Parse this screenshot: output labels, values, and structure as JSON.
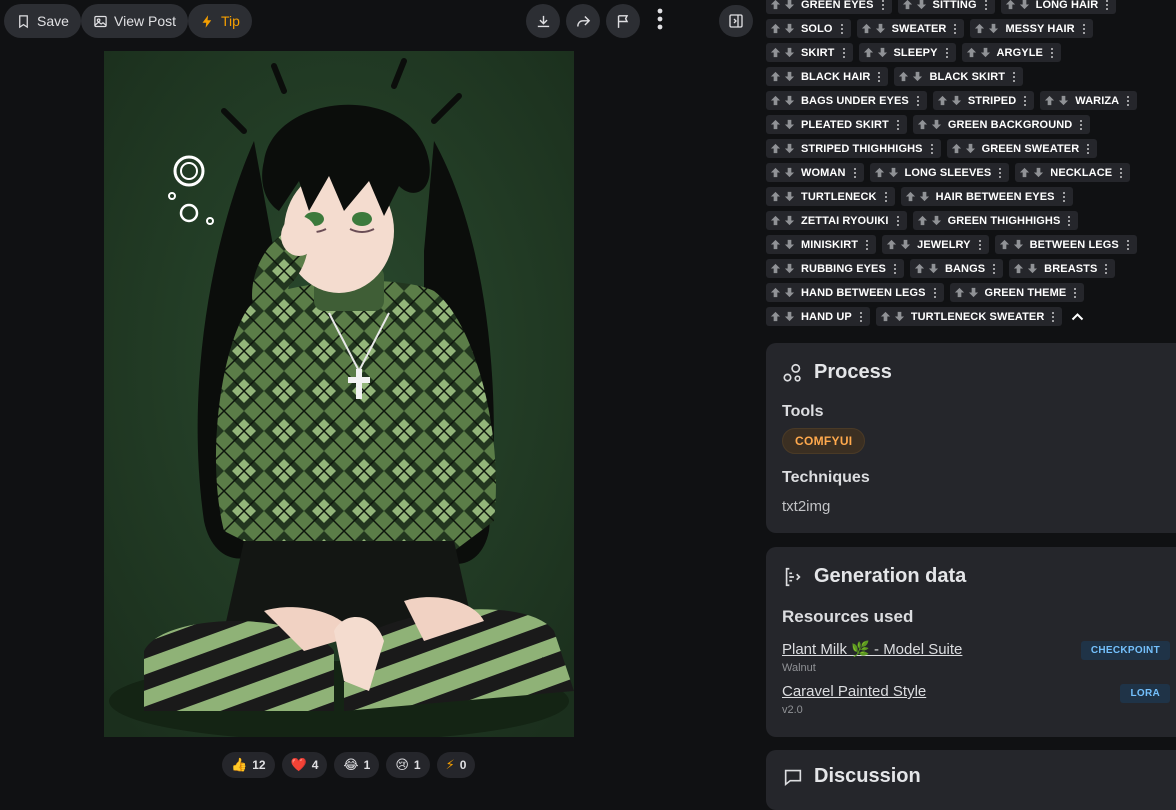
{
  "toolbar": {
    "save_label": "Save",
    "view_post_label": "View Post",
    "tip_label": "Tip"
  },
  "reactions": [
    {
      "emoji": "👍",
      "count": "12"
    },
    {
      "emoji": "❤️",
      "count": "4"
    },
    {
      "emoji": "😂",
      "count": "1"
    },
    {
      "emoji": "😢",
      "count": "1"
    },
    {
      "emoji": "⚡",
      "count": "0"
    }
  ],
  "tag_rows": [
    [
      "GREEN EYES",
      "SITTING",
      "LONG HAIR"
    ],
    [
      "SOLO",
      "SWEATER",
      "MESSY HAIR"
    ],
    [
      "SKIRT",
      "SLEEPY",
      "ARGYLE"
    ],
    [
      "BLACK HAIR",
      "BLACK SKIRT"
    ],
    [
      "BAGS UNDER EYES",
      "STRIPED",
      "WARIZA"
    ],
    [
      "PLEATED SKIRT",
      "GREEN BACKGROUND"
    ],
    [
      "STRIPED THIGHHIGHS",
      "GREEN SWEATER"
    ],
    [
      "WOMAN",
      "LONG SLEEVES",
      "NECKLACE"
    ],
    [
      "TURTLENECK",
      "HAIR BETWEEN EYES"
    ],
    [
      "ZETTAI RYOUIKI",
      "GREEN THIGHHIGHS"
    ],
    [
      "MINISKIRT",
      "JEWELRY",
      "BETWEEN LEGS"
    ],
    [
      "RUBBING EYES",
      "BANGS",
      "BREASTS"
    ],
    [
      "HAND BETWEEN LEGS",
      "GREEN THEME"
    ],
    [
      "HAND UP",
      "TURTLENECK SWEATER"
    ]
  ],
  "process": {
    "title": "Process",
    "tools_label": "Tools",
    "tool": "COMFYUI",
    "techniques_label": "Techniques",
    "technique": "txt2img"
  },
  "generation": {
    "title": "Generation data",
    "resources_label": "Resources used",
    "resources": [
      {
        "name": "Plant Milk 🌿 - Model Suite",
        "version": "Walnut",
        "type": "CHECKPOINT"
      },
      {
        "name": "Caravel Painted Style",
        "version": "v2.0",
        "type": "LORA"
      }
    ]
  },
  "discussion": {
    "title": "Discussion"
  },
  "colors": {
    "background": "#101113",
    "card": "#25262b",
    "accent_tip": "#f59f00",
    "badge_blue": "#74c0fc"
  }
}
